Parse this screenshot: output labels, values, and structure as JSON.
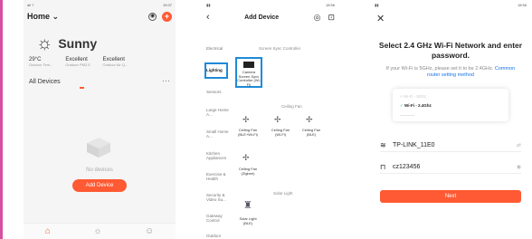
{
  "screen1": {
    "status_left": "ail ?",
    "status_right": "19:37",
    "title": "Home",
    "weather_label": "Sunny",
    "stats": [
      {
        "value": "29°C",
        "label": "Outdoor Tem..."
      },
      {
        "value": "Excellent",
        "label": "Outdoor PM2.5"
      },
      {
        "value": "Excellent",
        "label": "Outdoor Air Q..."
      }
    ],
    "all_devices": "All Devices",
    "no_devices": "No devices",
    "add_device_button": "Add Device",
    "nav": [
      "Home",
      "Scene",
      "Me"
    ],
    "accent_color": "#ff5a33"
  },
  "screen2": {
    "status_right": "18:56",
    "title": "Add Device",
    "categories": [
      "Electrical",
      "Lighting",
      "Sensors",
      "Large Home A...",
      "Small Home A...",
      "Kitchen Appliances",
      "Exercise & Health",
      "Security & Video Su...",
      "Gateway Control",
      "Outdoor"
    ],
    "active_category": "Lighting",
    "section_screen_sync": "Screen Sync Controller",
    "selected_device": "Camera Screen Sync Controller (Wi-Fi)",
    "section_ceiling_fan": "Ceiling Fan",
    "fans": [
      "Ceiling Fan (BLE+Wi-Fi)",
      "Ceiling Fan (Wi-Fi)",
      "Ceiling Fan (BLE)",
      "Ceiling Fan (Zigbee)"
    ],
    "section_solar": "Solar Light",
    "solar": "Solar Light (BLE)",
    "highlight_color": "#1d8bd8"
  },
  "screen3": {
    "status_right": "18:56",
    "title": "Select 2.4 GHz Wi-Fi Network and enter password.",
    "subtitle": "If your Wi-Fi is 5GHz, please set it to be 2.4GHz.",
    "subtitle_link": "Common router setting method",
    "band_5": "Wi-Fi - 5Ghz",
    "band_24": "Wi-Fi - 2.4Ghz",
    "network": "TP-LINK_11E0",
    "password": "cz123456",
    "next_button": "Next"
  }
}
